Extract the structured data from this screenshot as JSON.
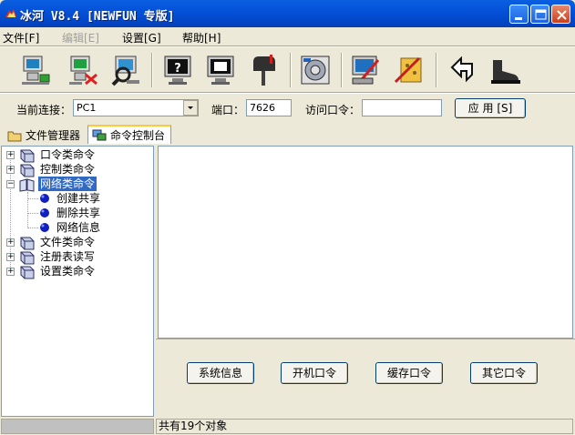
{
  "window": {
    "title": "冰河 V8.4 [NEWFUN 专版]",
    "controls": [
      "minimize",
      "maximize",
      "close"
    ]
  },
  "menu": [
    {
      "label": "文件[F]",
      "enabled": true
    },
    {
      "label": "编辑[E]",
      "enabled": false
    },
    {
      "label": "设置[G]",
      "enabled": true
    },
    {
      "label": "帮助[H]",
      "enabled": true
    }
  ],
  "toolbar": {
    "icons": [
      "add-host-icon",
      "delete-host-icon",
      "search-host-icon",
      "screen-info-icon",
      "screen-capture-icon",
      "mailbox-icon",
      "settings-disc-icon",
      "config-edit-icon",
      "tools-icon",
      "back-arrow-icon",
      "exit-boot-icon"
    ]
  },
  "connection": {
    "host_label": "当前连接：",
    "host_value": "PC1",
    "port_label": "端口：",
    "port_value": "7626",
    "password_label": "访问口令：",
    "password_value": "",
    "apply_label": "应 用 [S]"
  },
  "tabs": [
    {
      "label": "文件管理器",
      "active": false
    },
    {
      "label": "命令控制台",
      "active": true
    }
  ],
  "tree": [
    {
      "label": "口令类命令",
      "level": 0,
      "expanded": false,
      "selected": false
    },
    {
      "label": "控制类命令",
      "level": 0,
      "expanded": false,
      "selected": false
    },
    {
      "label": "网络类命令",
      "level": 0,
      "expanded": true,
      "selected": true
    },
    {
      "label": "创建共享",
      "level": 1,
      "expanded": false,
      "selected": false
    },
    {
      "label": "删除共享",
      "level": 1,
      "expanded": false,
      "selected": false
    },
    {
      "label": "网络信息",
      "level": 1,
      "expanded": false,
      "selected": false
    },
    {
      "label": "文件类命令",
      "level": 0,
      "expanded": false,
      "selected": false
    },
    {
      "label": "注册表读写",
      "level": 0,
      "expanded": false,
      "selected": false
    },
    {
      "label": "设置类命令",
      "level": 0,
      "expanded": false,
      "selected": false
    }
  ],
  "commands": {
    "system_info": "系统信息",
    "boot_password": "开机口令",
    "cached_password": "缓存口令",
    "other_password": "其它口令"
  },
  "status": {
    "count_text": "共有19个对象"
  },
  "colors": {
    "titlebar": "#0450d8",
    "selection": "#316ac5",
    "face": "#ece9d8"
  }
}
